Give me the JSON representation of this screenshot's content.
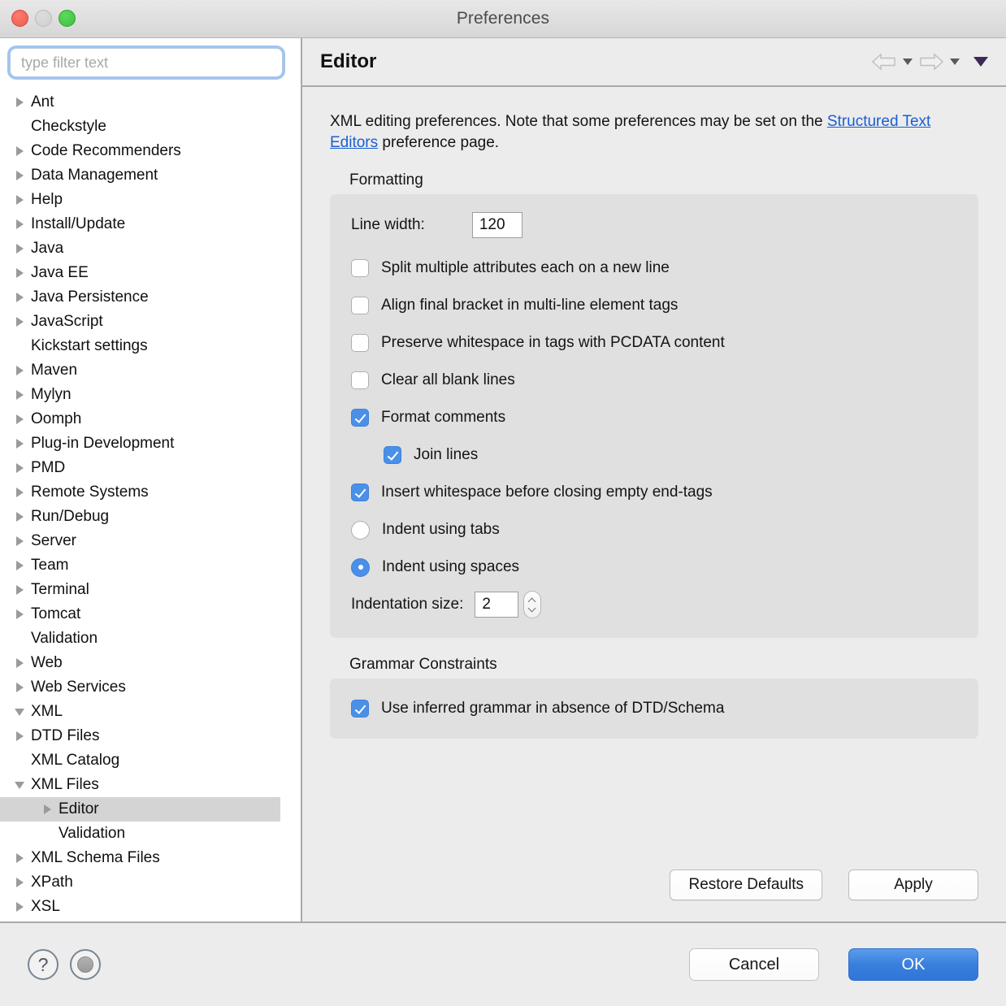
{
  "window": {
    "title": "Preferences",
    "traffic_lights": [
      "close",
      "minimize",
      "zoom"
    ]
  },
  "filter": {
    "placeholder": "type filter text",
    "value": ""
  },
  "tree": {
    "items": [
      {
        "label": "Ant",
        "indent": 0,
        "state": "collapsed",
        "selected": false
      },
      {
        "label": "Checkstyle",
        "indent": 0,
        "state": "leaf",
        "selected": false
      },
      {
        "label": "Code Recommenders",
        "indent": 0,
        "state": "collapsed",
        "selected": false
      },
      {
        "label": "Data Management",
        "indent": 0,
        "state": "collapsed",
        "selected": false
      },
      {
        "label": "Help",
        "indent": 0,
        "state": "collapsed",
        "selected": false
      },
      {
        "label": "Install/Update",
        "indent": 0,
        "state": "collapsed",
        "selected": false
      },
      {
        "label": "Java",
        "indent": 0,
        "state": "collapsed",
        "selected": false
      },
      {
        "label": "Java EE",
        "indent": 0,
        "state": "collapsed",
        "selected": false
      },
      {
        "label": "Java Persistence",
        "indent": 0,
        "state": "collapsed",
        "selected": false
      },
      {
        "label": "JavaScript",
        "indent": 0,
        "state": "collapsed",
        "selected": false
      },
      {
        "label": "Kickstart settings",
        "indent": 0,
        "state": "leaf",
        "selected": false
      },
      {
        "label": "Maven",
        "indent": 0,
        "state": "collapsed",
        "selected": false
      },
      {
        "label": "Mylyn",
        "indent": 0,
        "state": "collapsed",
        "selected": false
      },
      {
        "label": "Oomph",
        "indent": 0,
        "state": "collapsed",
        "selected": false
      },
      {
        "label": "Plug-in Development",
        "indent": 0,
        "state": "collapsed",
        "selected": false
      },
      {
        "label": "PMD",
        "indent": 0,
        "state": "collapsed",
        "selected": false
      },
      {
        "label": "Remote Systems",
        "indent": 0,
        "state": "collapsed",
        "selected": false
      },
      {
        "label": "Run/Debug",
        "indent": 0,
        "state": "collapsed",
        "selected": false
      },
      {
        "label": "Server",
        "indent": 0,
        "state": "collapsed",
        "selected": false
      },
      {
        "label": "Team",
        "indent": 0,
        "state": "collapsed",
        "selected": false
      },
      {
        "label": "Terminal",
        "indent": 0,
        "state": "collapsed",
        "selected": false
      },
      {
        "label": "Tomcat",
        "indent": 0,
        "state": "collapsed",
        "selected": false
      },
      {
        "label": "Validation",
        "indent": 0,
        "state": "leaf",
        "selected": false
      },
      {
        "label": "Web",
        "indent": 0,
        "state": "collapsed",
        "selected": false
      },
      {
        "label": "Web Services",
        "indent": 0,
        "state": "collapsed",
        "selected": false
      },
      {
        "label": "XML",
        "indent": 0,
        "state": "expanded",
        "selected": false
      },
      {
        "label": "DTD Files",
        "indent": 1,
        "state": "collapsed",
        "selected": false
      },
      {
        "label": "XML Catalog",
        "indent": 1,
        "state": "leaf",
        "selected": false
      },
      {
        "label": "XML Files",
        "indent": 1,
        "state": "expanded",
        "selected": false
      },
      {
        "label": "Editor",
        "indent": 2,
        "state": "collapsed",
        "selected": true
      },
      {
        "label": "Validation",
        "indent": 2,
        "state": "leaf",
        "selected": false
      },
      {
        "label": "XML Schema Files",
        "indent": 1,
        "state": "collapsed",
        "selected": false
      },
      {
        "label": "XPath",
        "indent": 1,
        "state": "collapsed",
        "selected": false
      },
      {
        "label": "XSL",
        "indent": 1,
        "state": "collapsed",
        "selected": false
      }
    ]
  },
  "page": {
    "title": "Editor",
    "nav": {
      "back_icon": "back-arrow-icon",
      "back_menu_icon": "chevron-down-icon",
      "forward_icon": "forward-arrow-icon",
      "forward_menu_icon": "chevron-down-icon",
      "menu_icon": "triangle-down-icon",
      "menu_color": "#3c2a56"
    },
    "description": {
      "before_link": "XML editing preferences.  Note that some preferences may be set on the ",
      "link": "Structured Text Editors",
      "after_link": " preference page.",
      "link_color": "#1a5fd0"
    },
    "formatting": {
      "title": "Formatting",
      "line_width_label": "Line width:",
      "line_width_value": "120",
      "options": [
        {
          "label": "Split multiple attributes each on a new line",
          "type": "checkbox",
          "checked": false,
          "sub": false
        },
        {
          "label": "Align final bracket in multi-line element tags",
          "type": "checkbox",
          "checked": false,
          "sub": false
        },
        {
          "label": "Preserve whitespace in tags with PCDATA content",
          "type": "checkbox",
          "checked": false,
          "sub": false
        },
        {
          "label": "Clear all blank lines",
          "type": "checkbox",
          "checked": false,
          "sub": false
        },
        {
          "label": "Format comments",
          "type": "checkbox",
          "checked": true,
          "sub": false
        },
        {
          "label": "Join lines",
          "type": "checkbox",
          "checked": true,
          "sub": true
        },
        {
          "label": "Insert whitespace before closing empty end-tags",
          "type": "checkbox",
          "checked": true,
          "sub": false
        },
        {
          "label": "Indent using tabs",
          "type": "radio",
          "checked": false,
          "sub": false
        },
        {
          "label": "Indent using spaces",
          "type": "radio",
          "checked": true,
          "sub": false
        }
      ],
      "indentation_label": "Indentation size:",
      "indentation_value": "2"
    },
    "grammar": {
      "title": "Grammar Constraints",
      "option_label": "Use inferred grammar in absence of DTD/Schema",
      "option_checked": true
    },
    "actions": {
      "restore_defaults": "Restore Defaults",
      "apply": "Apply"
    }
  },
  "footer": {
    "help_icon": "question-mark-icon",
    "help_glyph": "?",
    "secondary_icon": "circle-dot-icon",
    "cancel": "Cancel",
    "ok": "OK",
    "ok_color": "#3a7fdd"
  }
}
